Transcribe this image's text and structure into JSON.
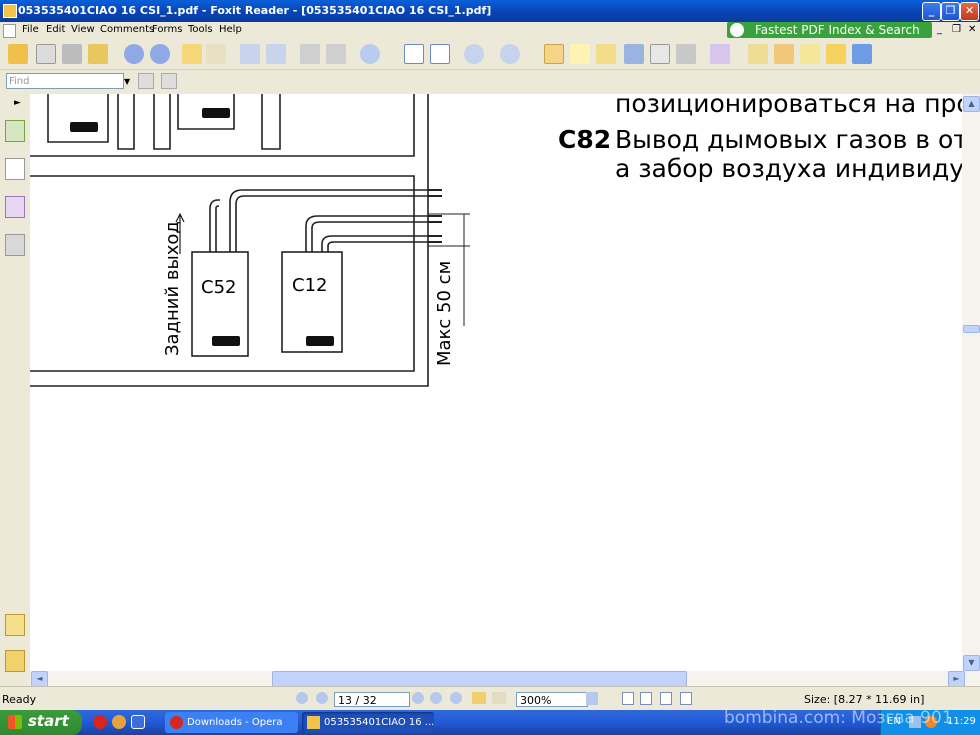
{
  "window": {
    "title": "053535401CIAO 16 CSI_1.pdf - Foxit Reader - [053535401CIAO 16 CSI_1.pdf]"
  },
  "menu": {
    "items": [
      "File",
      "Edit",
      "View",
      "Comments",
      "Forms",
      "Tools",
      "Help"
    ],
    "ad_label": "Fastest PDF Index & Search"
  },
  "find": {
    "placeholder": "Find"
  },
  "document": {
    "line1": "позиционироваться на прот",
    "code": "C82",
    "line2": "Вывод дымовых газов в отд",
    "line3": "а забор воздуха индивидуа.",
    "label_rear": "Задний выход",
    "label_c52": "C52",
    "label_c12": "C12",
    "label_max": "Макс 50 см"
  },
  "status": {
    "ready": "Ready",
    "page": "13 / 32",
    "zoom": "300%",
    "size": "Size: [8.27 * 11.69 in]"
  },
  "taskbar": {
    "start": "start",
    "task1": "Downloads - Opera",
    "task2": "053535401CIAO 16 ...",
    "lang": "EN",
    "clock": "11:29"
  },
  "watermark": "bombina.com: Мозгва 901",
  "colors": {
    "titlebar": "#0a5fd8",
    "taskbar": "#245edb",
    "start": "#3c9a3c",
    "ad": "#39a23c"
  }
}
